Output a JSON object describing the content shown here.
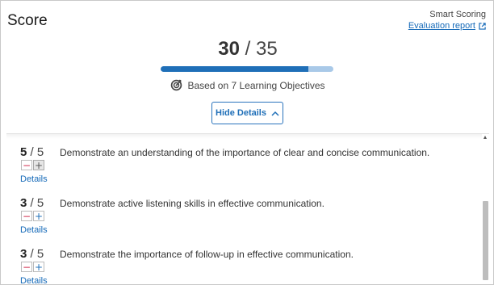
{
  "header": {
    "title": "Score",
    "smart_scoring_label": "Smart Scoring",
    "evaluation_report_link": "Evaluation report"
  },
  "score": {
    "earned": "30",
    "separator": "/",
    "total": "35",
    "progress_fraction": 0.857
  },
  "objectives_summary": {
    "text": "Based on 7 Learning Objectives",
    "icon": "target-icon"
  },
  "toggle": {
    "label": "Hide Details",
    "icon": "chevron-up-icon"
  },
  "objectives": [
    {
      "earned": "5",
      "max": "/ 5",
      "text": "Demonstrate an understanding of the importance of clear and concise communication.",
      "details_label": "Details",
      "minus": "−",
      "plus": "+",
      "plus_disabled": true
    },
    {
      "earned": "3",
      "max": "/ 5",
      "text": "Demonstrate active listening skills in effective communication.",
      "details_label": "Details",
      "minus": "−",
      "plus": "+",
      "plus_disabled": false
    },
    {
      "earned": "3",
      "max": "/ 5",
      "text": "Demonstrate the importance of follow-up in effective communication.",
      "details_label": "Details",
      "minus": "−",
      "plus": "+",
      "plus_disabled": false
    }
  ],
  "colors": {
    "accent": "#1f6fb8",
    "progress_track": "#a9c9e8",
    "minus_red": "#d22f4f",
    "link": "#1469b8"
  }
}
